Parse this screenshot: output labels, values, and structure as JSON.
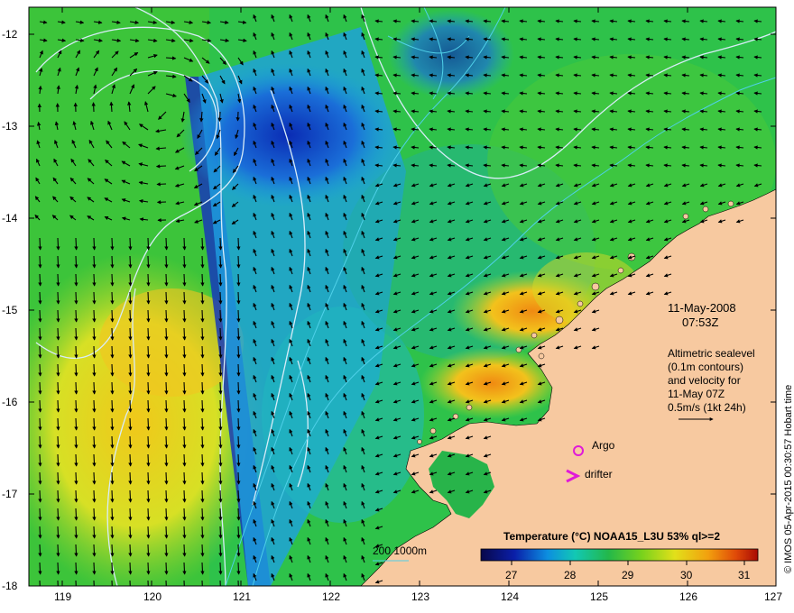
{
  "map": {
    "date": "11-May-2008",
    "time": "07:53Z",
    "legend_lines": [
      "Altimetric sealevel",
      "(0.1m contours)",
      "and velocity for",
      "11-May 07Z",
      "0.5m/s (1kt 24h)"
    ],
    "argo_label": "Argo",
    "drifter_label": "drifter",
    "depth_label": "200  1000m",
    "credit": "© IMOS 05-Apr-2015 00:30:57 Hobart time",
    "colors": {
      "land": "#f7c9a0",
      "argo": "#e01ad8",
      "drifter": "#e01ad8",
      "contour_sealevel": "#d8ecf8",
      "contour_depth": "#4fd0e8",
      "arrow": "#000000"
    }
  },
  "colorbar": {
    "title": "Temperature (°C) NOAA15_L3U 53% ql>=2",
    "ticks": [
      "27",
      "28",
      "29",
      "30",
      "31"
    ],
    "range": [
      26.5,
      31.2
    ]
  },
  "chart_data": {
    "type": "map",
    "xlim": [
      118.6,
      127
    ],
    "ylim": [
      -18,
      -11.8
    ],
    "x_ticks": [
      "119",
      "120",
      "121",
      "122",
      "123",
      "124",
      "125",
      "126",
      "127"
    ],
    "y_ticks": [
      "-12",
      "-13",
      "-14",
      "-15",
      "-16",
      "-17",
      "-18"
    ],
    "markers": [
      {
        "label": "Argo",
        "lon": 124.77,
        "lat": -16.75
      },
      {
        "label": "drifter",
        "lon": 124.68,
        "lat": -16.78
      }
    ]
  }
}
